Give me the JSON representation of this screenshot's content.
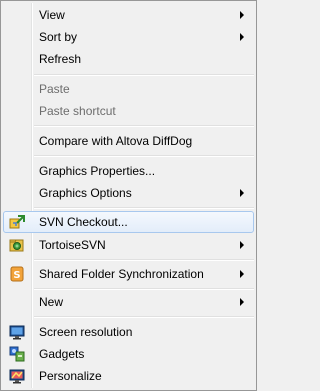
{
  "menu": {
    "view": "View",
    "sort_by": "Sort by",
    "refresh": "Refresh",
    "paste": "Paste",
    "paste_shortcut": "Paste shortcut",
    "compare": "Compare with Altova DiffDog",
    "graphics_properties": "Graphics Properties...",
    "graphics_options": "Graphics Options",
    "svn_checkout": "SVN Checkout...",
    "tortoise_svn": "TortoiseSVN",
    "shared_folder_sync": "Shared Folder Synchronization",
    "new": "New",
    "screen_resolution": "Screen resolution",
    "gadgets": "Gadgets",
    "personalize": "Personalize"
  },
  "icons": {
    "svn_checkout": "svn-checkout-icon",
    "tortoise_svn": "tortoise-svn-icon",
    "shared_folder_sync": "shared-folder-sync-icon",
    "screen_resolution": "screen-resolution-icon",
    "gadgets": "gadgets-icon",
    "personalize": "personalize-icon"
  },
  "colors": {
    "menu_background": "#f0f0f0",
    "menu_border": "#979797",
    "highlight_border": "#a8c8ee",
    "disabled_text": "#6d6d6d"
  }
}
